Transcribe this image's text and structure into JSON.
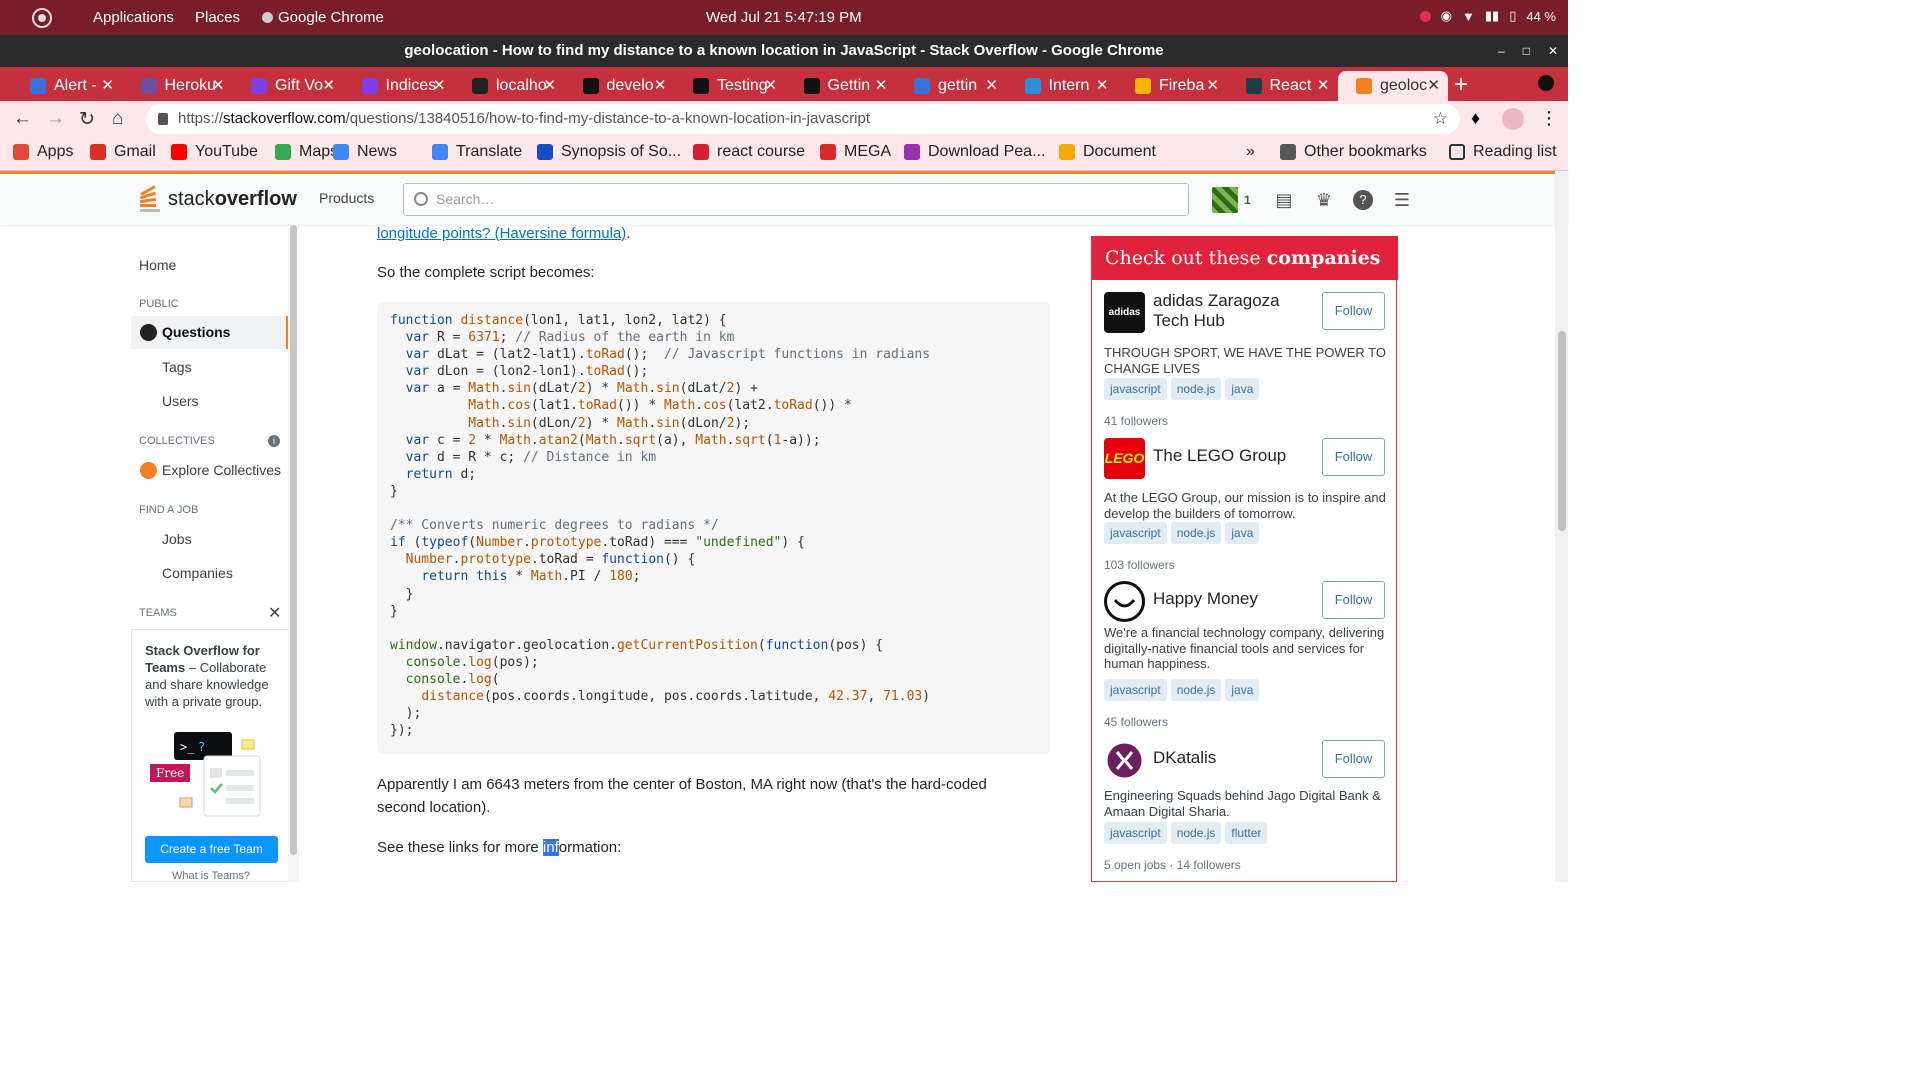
{
  "system_bar": {
    "menus": [
      "Applications",
      "Places",
      "Google Chrome"
    ],
    "clock": "Wed Jul 21   5:47:19 PM",
    "battery": "44 %"
  },
  "window": {
    "title": "geolocation - How to find my distance to a known location in JavaScript - Stack Overflow - Google Chrome"
  },
  "tabs": [
    {
      "label": "Alert -",
      "color": "#3b6fd9"
    },
    {
      "label": "Heroku",
      "color": "#6b4fa0"
    },
    {
      "label": "Gift Vo",
      "color": "#7b3fe4"
    },
    {
      "label": "Indices",
      "color": "#7b3fe4"
    },
    {
      "label": "localho",
      "color": "#222222"
    },
    {
      "label": "develo",
      "color": "#111111"
    },
    {
      "label": "Testing",
      "color": "#111111"
    },
    {
      "label": "Gettin",
      "color": "#111111"
    },
    {
      "label": "gettin",
      "color": "#3b6fd9"
    },
    {
      "label": "Intern",
      "color": "#2a8fd8"
    },
    {
      "label": "Fireba",
      "color": "#f5b400"
    },
    {
      "label": "React",
      "color": "#1b3f44"
    },
    {
      "label": "geoloc",
      "color": "#f48024"
    }
  ],
  "address": {
    "prefix": "https://",
    "host": "stackoverflow.com",
    "path": "/questions/13840516/how-to-find-my-distance-to-a-known-location-in-javascript"
  },
  "bookmarks": [
    {
      "label": "Apps",
      "color": "#e04a3a"
    },
    {
      "label": "Gmail",
      "color": "#d93025"
    },
    {
      "label": "YouTube",
      "color": "#ff0000"
    },
    {
      "label": "Maps",
      "color": "#34a853"
    },
    {
      "label": "News",
      "color": "#4285f4"
    },
    {
      "label": "Translate",
      "color": "#4285f4"
    },
    {
      "label": "Synopsis of So...",
      "color": "#1a4fc4"
    },
    {
      "label": "react course",
      "color": "#d6202e"
    },
    {
      "label": "MEGA",
      "color": "#d9272e"
    },
    {
      "label": "Download Pea...",
      "color": "#9a2fb0"
    },
    {
      "label": "Document",
      "color": "#f2a900"
    }
  ],
  "bookmarks_right": {
    "other": "Other bookmarks",
    "reading": "Reading list"
  },
  "so_header": {
    "logo_light": "stack",
    "logo_bold": "overflow",
    "products": "Products",
    "search_placeholder": "Search…",
    "reputation": "1"
  },
  "left_nav": {
    "home": "Home",
    "public": "PUBLIC",
    "questions": "Questions",
    "tags": "Tags",
    "users": "Users",
    "collectives": "COLLECTIVES",
    "explore": "Explore Collectives",
    "find_job": "FIND A JOB",
    "jobs": "Jobs",
    "companies": "Companies",
    "teams": "TEAMS",
    "teams_bold": "Stack Overflow for Teams",
    "teams_text": " – Collaborate and share knowledge with a private group.",
    "free_badge": "Free",
    "create_team": "Create a free Team",
    "what_teams": "What is Teams?"
  },
  "post": {
    "link_text": "longitude points? (Haversine formula)",
    "link_suffix": ".",
    "intro": "So the complete script becomes:",
    "after_code": "Apparently I am 6643 meters from the center of Boston, MA right now (that's the hard-coded second location).",
    "see_links_a": "See these links for more ",
    "see_links_hl": "inf",
    "see_links_b": "ormation:"
  },
  "companies_panel": {
    "title_light": "Check out these ",
    "title_bold": "companies",
    "items": [
      {
        "name": "adidas Zaragoza Tech Hub",
        "logo_text": "adidas",
        "follow": "Follow",
        "desc": "THROUGH SPORT, WE HAVE THE POWER TO CHANGE LIVES",
        "tags": [
          "javascript",
          "node.js",
          "java"
        ],
        "meta": "41 followers"
      },
      {
        "name": "The LEGO Group",
        "logo_text": "LEGO",
        "follow": "Follow",
        "desc": "At the LEGO Group, our mission is to inspire and develop the builders of tomorrow.",
        "tags": [
          "javascript",
          "node.js",
          "java"
        ],
        "meta": "103 followers"
      },
      {
        "name": "Happy Money",
        "logo_text": "",
        "follow": "Follow",
        "desc": "We're a financial technology company, delivering digitally-native financial tools and services for human happiness.",
        "tags": [
          "javascript",
          "node.js",
          "java"
        ],
        "meta": "45 followers"
      },
      {
        "name": "DKatalis",
        "logo_text": "",
        "follow": "Follow",
        "desc": "Engineering Squads behind Jago Digital Bank & Amaan Digital Sharia.",
        "tags": [
          "javascript",
          "node.js",
          "flutter"
        ],
        "meta": "5 open jobs · 14 followers"
      }
    ]
  }
}
